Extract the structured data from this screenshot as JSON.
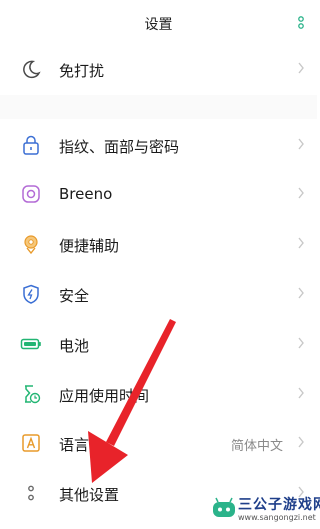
{
  "header": {
    "title": "设置",
    "search_icon": "search-icon"
  },
  "rows": [
    {
      "id": "dnd",
      "label": "免打扰",
      "icon": "moon-icon",
      "color": "#4a4a4a"
    },
    {
      "id": "security-id",
      "label": "指纹、面部与密码",
      "icon": "lock-icon",
      "color": "#3b6fd4"
    },
    {
      "id": "breeno",
      "label": "Breeno",
      "icon": "breeno-icon",
      "color": "#b36bd6"
    },
    {
      "id": "accessibility",
      "label": "便捷辅助",
      "icon": "hand-icon",
      "color": "#e89a2a"
    },
    {
      "id": "safety",
      "label": "安全",
      "icon": "shield-icon",
      "color": "#3b6fd4"
    },
    {
      "id": "battery",
      "label": "电池",
      "icon": "battery-icon",
      "color": "#22b573"
    },
    {
      "id": "app-usage",
      "label": "应用使用时间",
      "icon": "hourglass-icon",
      "color": "#22b573"
    },
    {
      "id": "language",
      "label": "语言",
      "value": "简体中文",
      "icon": "language-icon",
      "color": "#e89a2a"
    },
    {
      "id": "other",
      "label": "其他设置",
      "icon": "dots-icon",
      "color": "#6a6a6a"
    }
  ],
  "annotation": {
    "arrow_color": "#e8232a"
  },
  "watermark": {
    "name": "三公子游戏网",
    "url": "www.sangongzi.net"
  }
}
